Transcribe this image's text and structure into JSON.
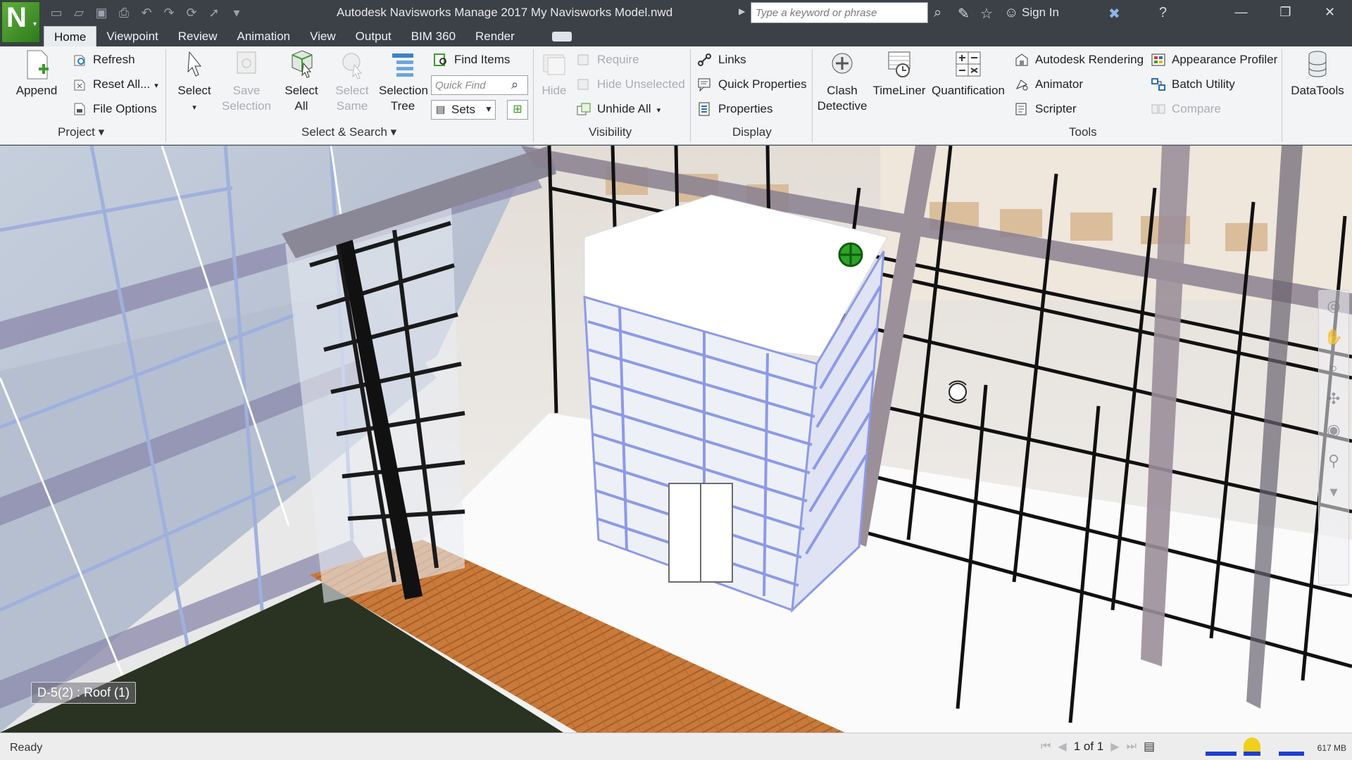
{
  "titlebar": {
    "app_title": "Autodesk Navisworks Manage 2017    My Navisworks Model.nwd",
    "search_placeholder": "Type a keyword or phrase",
    "sign_in": "Sign In"
  },
  "tabs": [
    "Home",
    "Viewpoint",
    "Review",
    "Animation",
    "View",
    "Output",
    "BIM 360",
    "Render"
  ],
  "ribbon": {
    "project": {
      "title": "Project",
      "append": "Append",
      "refresh": "Refresh",
      "reset_all": "Reset All...",
      "file_options": "File Options"
    },
    "select_search": {
      "title": "Select & Search",
      "select": "Select",
      "save_selection": [
        "Save",
        "Selection"
      ],
      "select_all": [
        "Select",
        "All"
      ],
      "select_same": [
        "Select",
        "Same"
      ],
      "selection_tree": [
        "Selection",
        "Tree"
      ],
      "find_items": "Find Items",
      "quick_find_placeholder": "Quick Find",
      "sets": "Sets"
    },
    "visibility": {
      "title": "Visibility",
      "hide": "Hide",
      "require": "Require",
      "hide_unselected": "Hide Unselected",
      "unhide_all": "Unhide All"
    },
    "display": {
      "title": "Display",
      "links": "Links",
      "quick_properties": "Quick Properties",
      "properties": "Properties"
    },
    "tools": {
      "title": "Tools",
      "clash_detective": [
        "Clash",
        "Detective"
      ],
      "timeliner": "TimeLiner",
      "quantification": "Quantification",
      "autodesk_rendering": "Autodesk Rendering",
      "animator": "Animator",
      "scripter": "Scripter",
      "appearance_profiler": "Appearance Profiler",
      "batch_utility": "Batch Utility",
      "compare": "Compare",
      "datatools": "DataTools"
    }
  },
  "viewport": {
    "view_label": "D-5(2) : Roof (1)"
  },
  "statusbar": {
    "status": "Ready",
    "page": "1 of 1",
    "memory": "617 MB"
  },
  "colors": {
    "titlebar": "#3c4148",
    "ribbon": "#f3f4f6",
    "accent_green": "#3f9a2a"
  }
}
